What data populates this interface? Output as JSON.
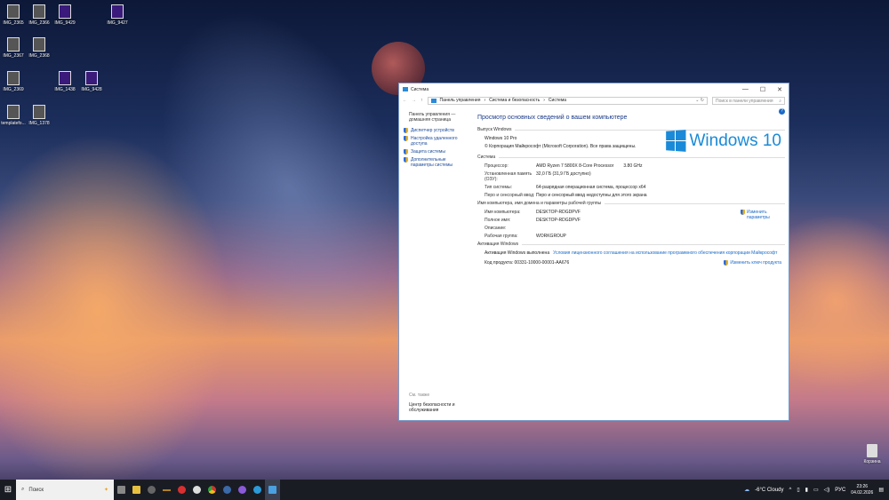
{
  "desktop": {
    "icons": [
      "IMG_2365",
      "IMG_2366",
      "IMG_9429",
      "IMG_9427",
      "IMG_2367",
      "IMG_2368",
      "IMG_2369",
      "IMG_1438",
      "IMG_9428",
      "templatefo...",
      "IMG_1378"
    ],
    "recycle_bin": "Корзина"
  },
  "window": {
    "title": "Система",
    "minimize": "—",
    "maximize": "☐",
    "close": "✕",
    "breadcrumb": [
      "Панель управления",
      "Система и безопасность",
      "Система"
    ],
    "search_placeholder": "Поиск в панели управления",
    "sidebar": {
      "home": "Панель управления — домашняя страница",
      "links": [
        "Диспетчер устройств",
        "Настройка удаленного доступа",
        "Защита системы",
        "Дополнительные параметры системы"
      ],
      "see_also": "См. также",
      "see_also_link": "Центр безопасности и обслуживания"
    },
    "heading": "Просмотр основных сведений о вашем компьютере",
    "edition": {
      "section": "Выпуск Windows",
      "name": "Windows 10 Pro",
      "copyright": "© Корпорация Майкрософт (Microsoft Corporation). Все права защищены.",
      "logo": "Windows 10"
    },
    "system": {
      "section": "Система",
      "rows": [
        {
          "k": "Процессор:",
          "v": "AMD Ryzen 7 5800X 8-Core Processor        3.80 GHz"
        },
        {
          "k": "Установленная память (ОЗУ):",
          "v": "32,0 ГБ (31,9 ГБ доступно)"
        },
        {
          "k": "Тип системы:",
          "v": "64-разрядная операционная система, процессор x64"
        },
        {
          "k": "Перо и сенсорный ввод:",
          "v": "Перо и сенсорный ввод недоступны для этого экрана"
        }
      ]
    },
    "computer": {
      "section": "Имя компьютера, имя домена и параметры рабочей группы",
      "change": "Изменить параметры",
      "rows": [
        {
          "k": "Имя компьютера:",
          "v": "DESKTOP-RDGDPVF"
        },
        {
          "k": "Полное имя:",
          "v": "DESKTOP-RDGDPVF"
        },
        {
          "k": "Описание:",
          "v": ""
        },
        {
          "k": "Рабочая группа:",
          "v": "WORKGROUP"
        }
      ]
    },
    "activation": {
      "section": "Активация Windows",
      "status": "Активация Windows выполнена",
      "license_link": "Условия лицензионного соглашения на использование программного обеспечения корпорации Майкрософт",
      "product_key_label": "Код продукта: 00331-10000-00001-AA676",
      "change_key": "Изменить ключ продукта"
    }
  },
  "taskbar": {
    "search": "Поиск",
    "weather": "-6°C  Cloudy",
    "lang": "РУС",
    "time": "23:26",
    "date": "04.02.2026"
  }
}
